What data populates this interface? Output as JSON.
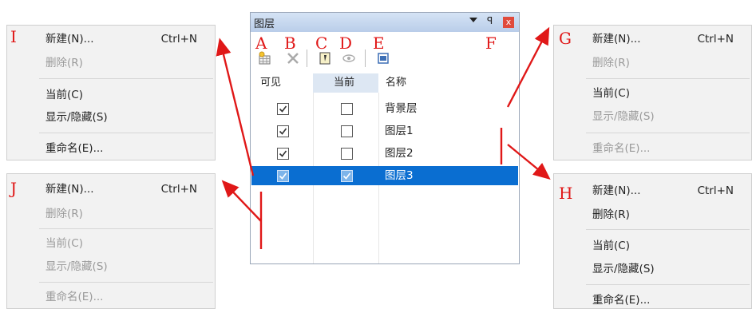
{
  "labels": {
    "I": "I",
    "J": "J",
    "G": "G",
    "H": "H",
    "A": "A",
    "B": "B",
    "C": "C",
    "D": "D",
    "E": "E",
    "F": "F"
  },
  "panel": {
    "title": "图层",
    "pin": "ꟼ",
    "close": "x",
    "headers": {
      "visible": "可见",
      "current": "当前",
      "name": "名称"
    },
    "rows": [
      {
        "name": "背景层",
        "visible": true,
        "current": false,
        "selected": false
      },
      {
        "name": "图层1",
        "visible": true,
        "current": false,
        "selected": false
      },
      {
        "name": "图层2",
        "visible": true,
        "current": false,
        "selected": false
      },
      {
        "name": "图层3",
        "visible": true,
        "current": true,
        "selected": true
      }
    ]
  },
  "menus": {
    "I": {
      "new": "新建(N)...",
      "shortcut": "Ctrl+N",
      "delete": "删除(R)",
      "current": "当前(C)",
      "toggle": "显示/隐藏(S)",
      "rename": "重命名(E)..."
    },
    "J": {
      "new": "新建(N)...",
      "shortcut": "Ctrl+N",
      "delete": "删除(R)",
      "current": "当前(C)",
      "toggle": "显示/隐藏(S)",
      "rename": "重命名(E)..."
    },
    "G": {
      "new": "新建(N)...",
      "shortcut": "Ctrl+N",
      "delete": "删除(R)",
      "current": "当前(C)",
      "toggle": "显示/隐藏(S)",
      "rename": "重命名(E)..."
    },
    "H": {
      "new": "新建(N)...",
      "shortcut": "Ctrl+N",
      "delete": "删除(R)",
      "current": "当前(C)",
      "toggle": "显示/隐藏(S)",
      "rename": "重命名(E)..."
    }
  },
  "colors": {
    "accent_red": "#e01818",
    "selection_blue": "#0a6ed1"
  }
}
